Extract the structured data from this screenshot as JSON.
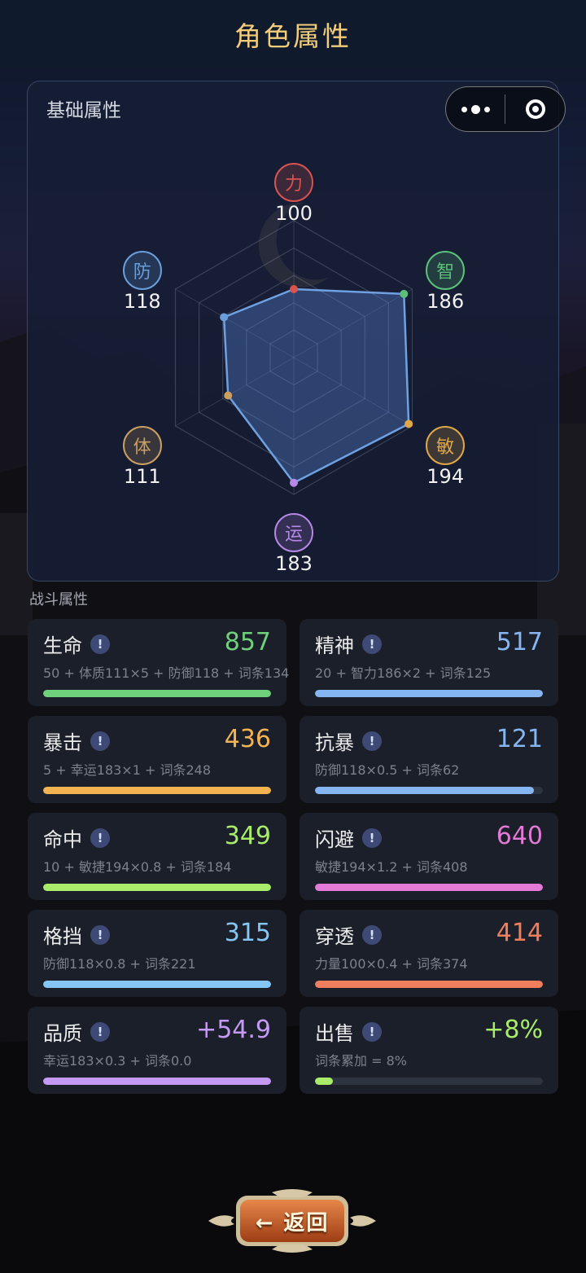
{
  "header": {
    "title": "角色属性"
  },
  "capsule": {
    "more_icon": "more-dots-icon",
    "close_icon": "target-icon"
  },
  "basic": {
    "title": "基础属性",
    "max": 200,
    "stats": [
      {
        "key": "strength",
        "label": "力",
        "value": 100,
        "value_text": "100",
        "color": "#d9534f"
      },
      {
        "key": "intellect",
        "label": "智",
        "value": 186,
        "value_text": "186",
        "color": "#5cbf7a"
      },
      {
        "key": "agility",
        "label": "敏",
        "value": 194,
        "value_text": "194",
        "color": "#e0a748"
      },
      {
        "key": "luck",
        "label": "运",
        "value": 183,
        "value_text": "183",
        "color": "#b689e6"
      },
      {
        "key": "constitution",
        "label": "体",
        "value": 111,
        "value_text": "111",
        "color": "#c9a062"
      },
      {
        "key": "defense",
        "label": "防",
        "value": 118,
        "value_text": "118",
        "color": "#6a9edb"
      }
    ]
  },
  "combat": {
    "title": "战斗属性",
    "cards": [
      {
        "name": "生命",
        "value": "857",
        "formula": "50 + 体质111×5 + 防御118 + 词条134",
        "color": "#6fd17c",
        "progress": 1.0
      },
      {
        "name": "精神",
        "value": "517",
        "formula": "20 + 智力186×2 + 词条125",
        "color": "#86b6f2",
        "progress": 1.0
      },
      {
        "name": "暴击",
        "value": "436",
        "formula": "5 + 幸运183×1 + 词条248",
        "color": "#f3b350",
        "progress": 1.0
      },
      {
        "name": "抗暴",
        "value": "121",
        "formula": "防御118×0.5 + 词条62",
        "color": "#86b6f2",
        "progress": 0.96
      },
      {
        "name": "命中",
        "value": "349",
        "formula": "10 + 敏捷194×0.8 + 词条184",
        "color": "#a9ec6a",
        "progress": 1.0
      },
      {
        "name": "闪避",
        "value": "640",
        "formula": "敏捷194×1.2 + 词条408",
        "color": "#e27ad6",
        "progress": 1.0
      },
      {
        "name": "格挡",
        "value": "315",
        "formula": "防御118×0.8 + 词条221",
        "color": "#86c6f5",
        "progress": 1.0
      },
      {
        "name": "穿透",
        "value": "414",
        "formula": "力量100×0.4 + 词条374",
        "color": "#ef7f5c",
        "progress": 1.0
      },
      {
        "name": "品质",
        "value": "+54.9",
        "formula": "幸运183×0.3 + 词条0.0",
        "color": "#c59af5",
        "progress": 1.0
      },
      {
        "name": "出售",
        "value": "+8%",
        "formula": "词条累加 = 8%",
        "color": "#a9ec6a",
        "progress": 0.08
      }
    ],
    "info_glyph": "!"
  },
  "back": {
    "label": "← 返回"
  }
}
